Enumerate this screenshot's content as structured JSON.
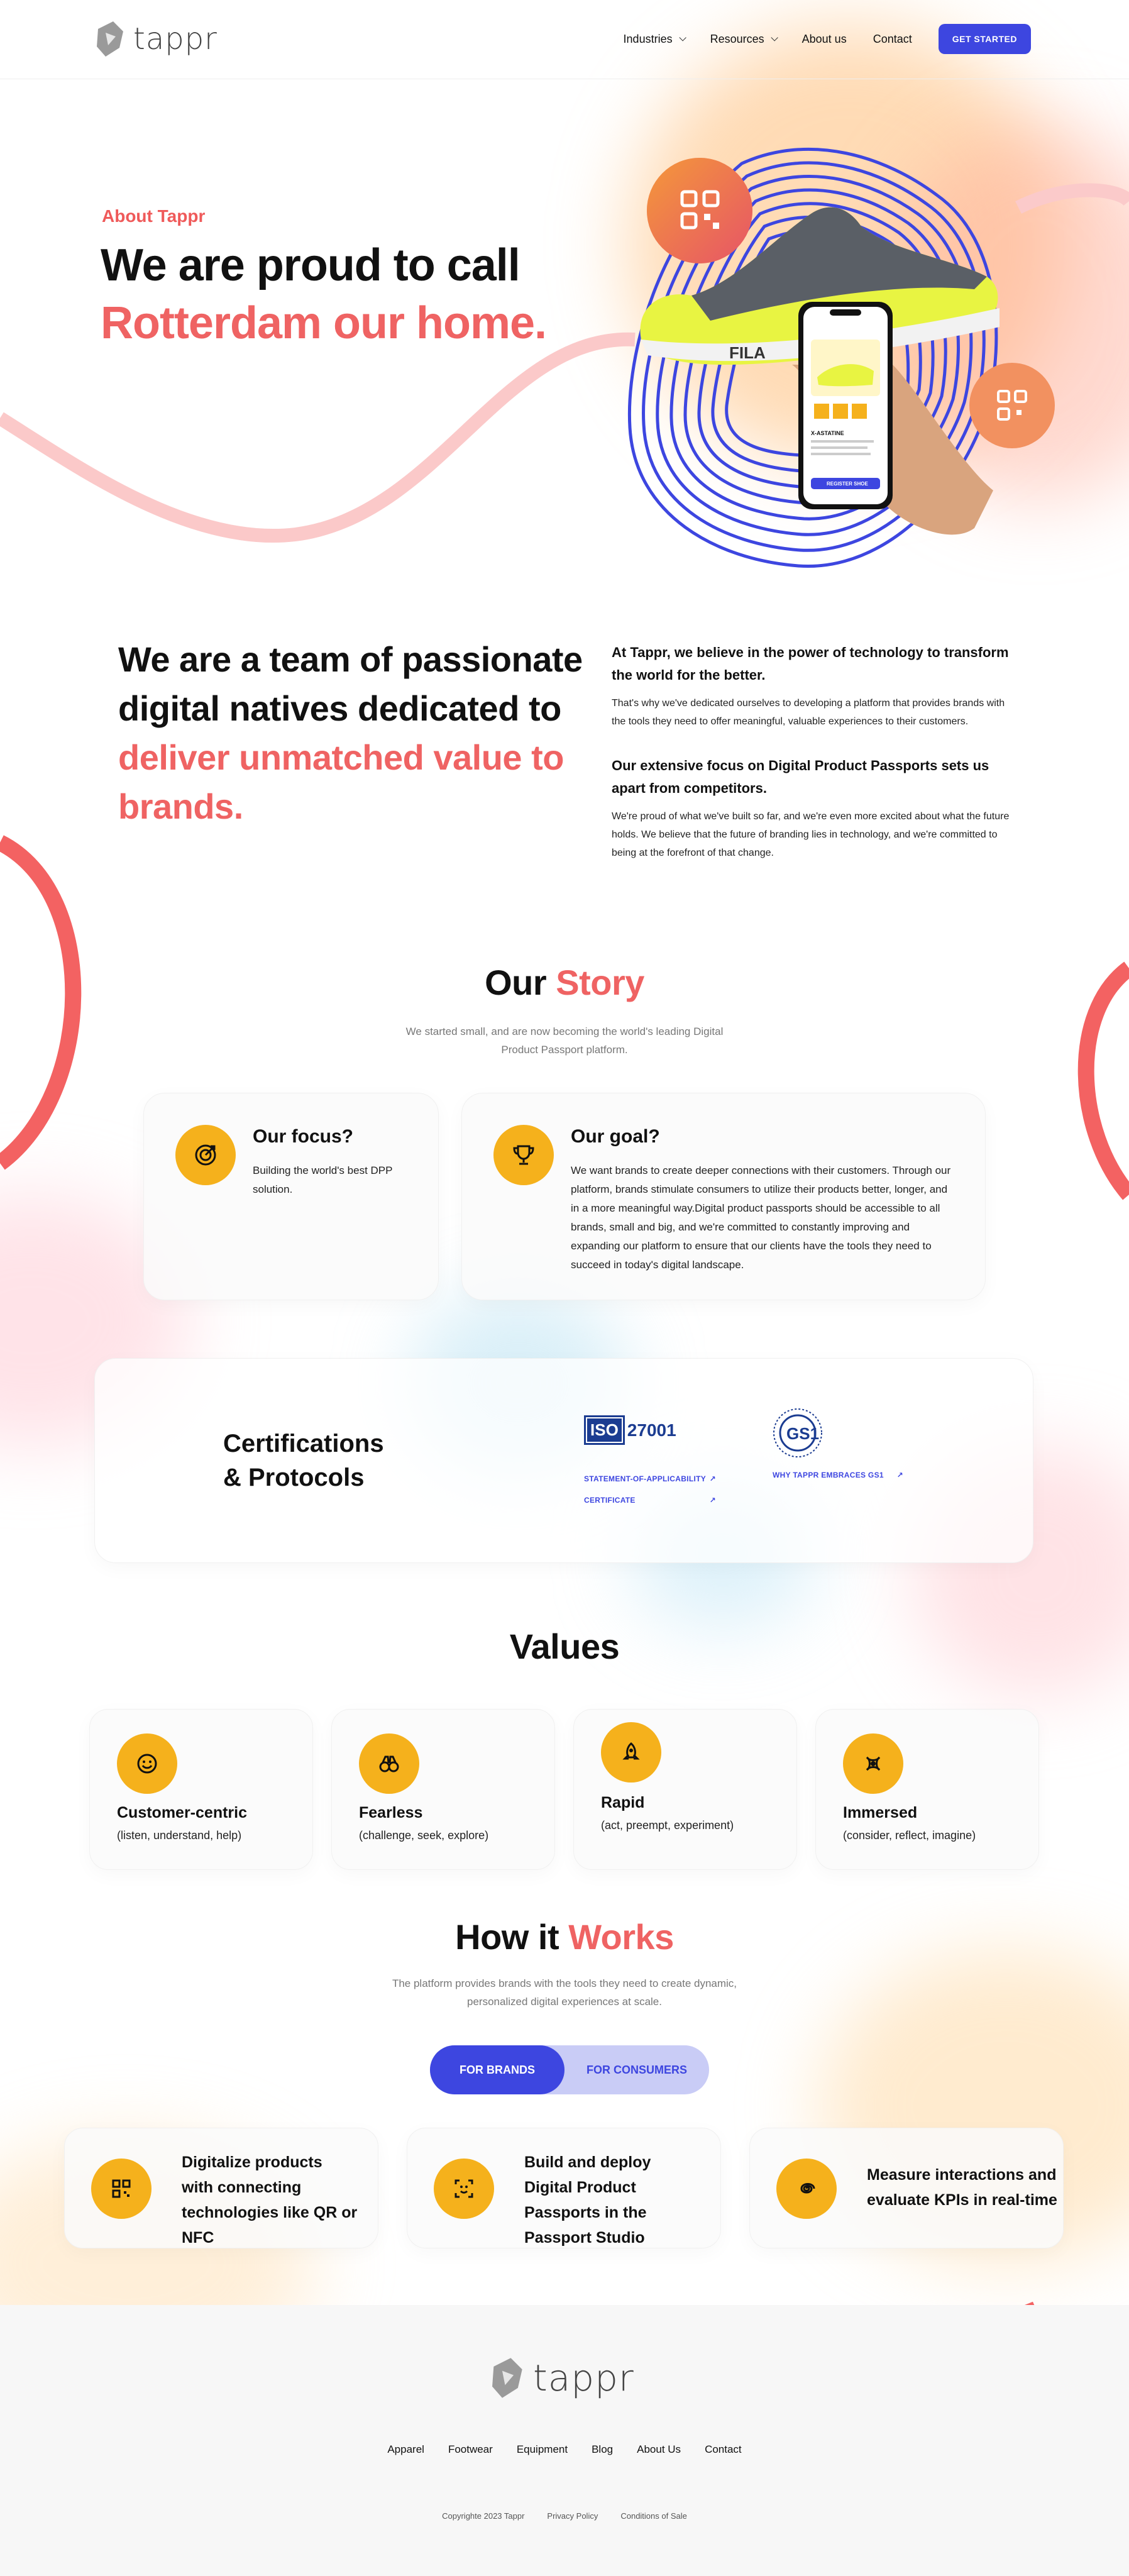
{
  "brand": {
    "name": "tappr",
    "logo_icon": "tappr-logo-icon"
  },
  "colors": {
    "accent_blue": "#3d46e0",
    "coral": "#ef6363",
    "icon_yellow": "#f5b11c"
  },
  "nav": {
    "items": [
      {
        "label": "Industries",
        "dropdown": true
      },
      {
        "label": "Resources",
        "dropdown": true
      },
      {
        "label": "About us",
        "dropdown": false
      },
      {
        "label": "Contact",
        "dropdown": false
      }
    ],
    "cta": "GET STARTED"
  },
  "hero": {
    "eyebrow": "About Tappr",
    "title_line1": "We are proud to call",
    "title_line2": "Rotterdam our home."
  },
  "phone": {
    "product_name": "X-ASTATINE",
    "button": "REGISTER SHOE"
  },
  "team": {
    "title_line1": "We are a team of passionate",
    "title_line2": "digital natives dedicated to",
    "title_line3": "deliver unmatched value to",
    "title_line4": "brands.",
    "block1_heading": "At Tappr, we believe in the power of technology to transform the world for the better.",
    "block1_text": "That's why we've dedicated ourselves to developing a platform that provides brands with the tools they need to offer meaningful, valuable experiences to their customers.",
    "block2_heading": "Our extensive focus on Digital Product Passports sets us apart from competitors.",
    "block2_text": "We're proud of what we've built so far, and we're even more excited about what the future holds. We believe that the future of branding lies in technology, and we're committed to being at the forefront of that change."
  },
  "story": {
    "title_a": "Our",
    "title_b": "Story",
    "subtitle": "We started small, and are now becoming the world's leading Digital Product Passport platform.",
    "focus": {
      "title": "Our focus?",
      "text": "Building the world's best DPP solution.",
      "icon": "target-icon"
    },
    "goal": {
      "title": "Our goal?",
      "text": "We want brands to create deeper connections with their customers. Through our platform, brands stimulate consumers to utilize their products better, longer, and in a more meaningful way.Digital product passports should be accessible to all brands, small and big, and we're committed to constantly improving and expanding our platform to ensure that our clients have the tools they need to succeed in today's digital landscape.",
      "icon": "trophy-icon"
    }
  },
  "certifications": {
    "title_line1": "Certifications",
    "title_line2": "& Protocols",
    "iso": {
      "badge": "ISO",
      "number": "27001",
      "links": [
        "STATEMENT-OF-APPLICABILITY",
        "CERTIFICATE"
      ]
    },
    "gs1": {
      "badge": "GS1",
      "links": [
        "WHY TAPPR EMBRACES GS1"
      ]
    }
  },
  "values": {
    "title": "Values",
    "items": [
      {
        "title": "Customer-centric",
        "sub": "(listen, understand, help)",
        "icon": "smiley-icon"
      },
      {
        "title": "Fearless",
        "sub": "(challenge, seek, explore)",
        "icon": "binoculars-icon"
      },
      {
        "title": "Rapid",
        "sub": "(act, preempt, experiment)",
        "icon": "rocket-icon"
      },
      {
        "title": "Immersed",
        "sub": "(consider, reflect, imagine)",
        "icon": "immersed-icon"
      }
    ]
  },
  "how": {
    "title_a": "How it",
    "title_b": "Works",
    "subtitle": "The platform provides brands with the tools they need to create dynamic, personalized digital experiences at scale.",
    "toggle_on": "FOR BRANDS",
    "toggle_off": "FOR CONSUMERS",
    "steps": [
      {
        "text": "Digitalize products with connecting technologies like QR or NFC",
        "icon": "qr-code-icon"
      },
      {
        "text": "Build and deploy Digital Product Passports in the Passport Studio",
        "icon": "scan-face-icon"
      },
      {
        "text": "Measure interactions and evaluate KPIs in real-time",
        "icon": "spiral-icon"
      }
    ]
  },
  "footer": {
    "links": [
      "Apparel",
      "Footwear",
      "Equipment",
      "Blog",
      "About Us",
      "Contact"
    ],
    "copyright": "Copyrighte 2023 Tappr",
    "privacy": "Privacy Policy",
    "conditions": "Conditions of Sale"
  }
}
